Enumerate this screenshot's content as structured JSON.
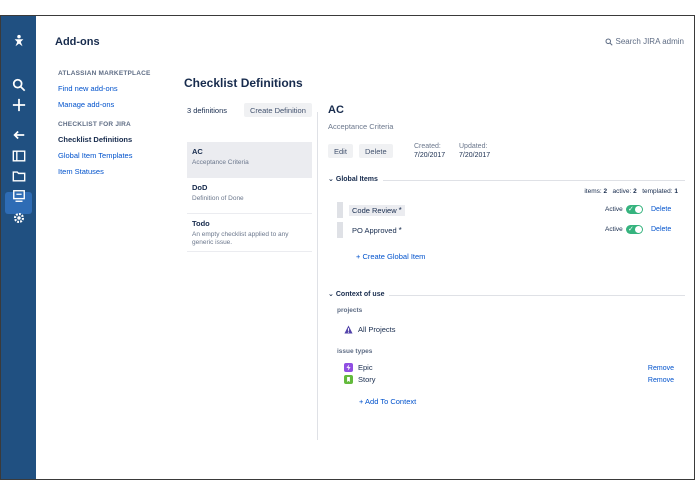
{
  "app": {
    "page_title": "Add-ons",
    "search_label": "Search JIRA admin"
  },
  "nav": {
    "icons": [
      "jira-logo-icon",
      "search-icon",
      "plus-icon",
      "back-arrow-icon",
      "board-icon",
      "folder-icon",
      "dashboard-icon",
      "gear-icon"
    ]
  },
  "sidebar": {
    "marketplace_heading": "ATLASSIAN MARKETPLACE",
    "find_new": "Find new add-ons",
    "manage": "Manage add-ons",
    "checklist_heading": "CHECKLIST FOR JIRA",
    "checklist_defs": "Checklist Definitions",
    "global_templates": "Global Item Templates",
    "item_statuses": "Item Statuses"
  },
  "definitions": {
    "title": "Checklist Definitions",
    "count_label": "3 definitions",
    "create_button": "Create Definition",
    "items": [
      {
        "name": "AC",
        "desc": "Acceptance Criteria"
      },
      {
        "name": "DoD",
        "desc": "Definition of Done"
      },
      {
        "name": "Todo",
        "desc": "An empty checklist applied to any generic issue."
      }
    ]
  },
  "detail": {
    "title": "AC",
    "description": "Acceptance Criteria",
    "edit_button": "Edit",
    "delete_button": "Delete",
    "created_label": "Created:",
    "created_value": "7/20/2017",
    "updated_label": "Updated:",
    "updated_value": "7/20/2017",
    "global_items_heading": "Global Items",
    "stats": {
      "items_label": "items:",
      "items": "2",
      "active_label": "active:",
      "active": "2",
      "templated_label": "templated:",
      "templated": "1"
    },
    "global_items": [
      {
        "name": "Code Review",
        "star": "*",
        "active_label": "Active",
        "delete": "Delete"
      },
      {
        "name": "PO Approved",
        "star": "*",
        "active_label": "Active",
        "delete": "Delete"
      }
    ],
    "create_global_item": "+ Create Global Item",
    "context_heading": "Context of use",
    "projects_heading": "projects",
    "all_projects": "All Projects",
    "issue_types_heading": "issue types",
    "issue_types": [
      {
        "name": "Epic",
        "color": "#904ee2",
        "remove": "Remove"
      },
      {
        "name": "Story",
        "color": "#63ba3c",
        "remove": "Remove"
      }
    ],
    "add_to_context": "+ Add To Context"
  },
  "colors": {
    "nav_bg": "#205081",
    "link": "#0052cc",
    "toggle_on": "#36b37e",
    "project_icon": "#5243aa"
  }
}
